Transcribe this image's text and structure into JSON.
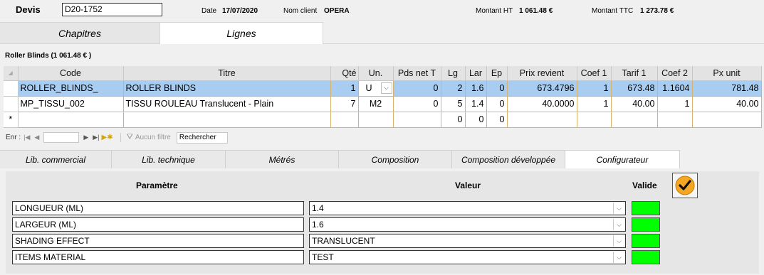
{
  "header": {
    "devis_label": "Devis",
    "devis_value": "D20-1752",
    "date_label": "Date",
    "date_value": "17/07/2020",
    "client_label": "Nom client",
    "client_value": "OPERA",
    "ht_label": "Montant HT",
    "ht_value": "1 061.48 €",
    "ttc_label": "Montant TTC",
    "ttc_value": "1 273.78 €"
  },
  "main_tabs": [
    "Chapitres",
    "Lignes"
  ],
  "section_title": "Roller Blinds  (1 061.48 € )",
  "grid": {
    "columns": [
      "Code",
      "Titre",
      "Qté",
      "Un.",
      "Pds net T",
      "Lg",
      "Lar",
      "Ep",
      "Prix revient",
      "Coef 1",
      "Tarif 1",
      "Coef 2",
      "Px unit"
    ],
    "rows": [
      [
        "ROLLER_BLINDS_",
        "ROLLER BLINDS",
        "1",
        "U",
        "0",
        "2",
        "1.6",
        "0",
        "673.4796",
        "1",
        "673.48",
        "1.1604",
        "781.48"
      ],
      [
        "MP_TISSU_002",
        "TISSU ROULEAU Translucent - Plain",
        "7",
        "M2",
        "0",
        "5",
        "1.4",
        "0",
        "40.0000",
        "1",
        "40.00",
        "1",
        "40.00"
      ]
    ],
    "new_row": [
      "",
      "",
      "",
      "",
      "",
      "0",
      "0",
      "0",
      "",
      "",
      "",
      "",
      ""
    ],
    "new_row_marker": "*"
  },
  "navbar": {
    "record_label": "Enr :",
    "filter_label": "Aucun filtre",
    "search_label": "Rechercher"
  },
  "sub_tabs": [
    "Lib. commercial",
    "Lib. technique",
    "Métrés",
    "Composition",
    "Composition développée",
    "Configurateur"
  ],
  "configurator": {
    "param_header": "Paramètre",
    "value_header": "Valeur",
    "valid_header": "Valide",
    "rows": [
      {
        "param": "LONGUEUR (ML)",
        "value": "1.4"
      },
      {
        "param": "LARGEUR (ML)",
        "value": "1.6"
      },
      {
        "param": "SHADING EFFECT",
        "value": "TRANSLUCENT"
      },
      {
        "param": "ITEMS MATERIAL",
        "value": "TEST"
      }
    ],
    "valid_color": "#00ff00",
    "check_color": "#f5a623"
  }
}
